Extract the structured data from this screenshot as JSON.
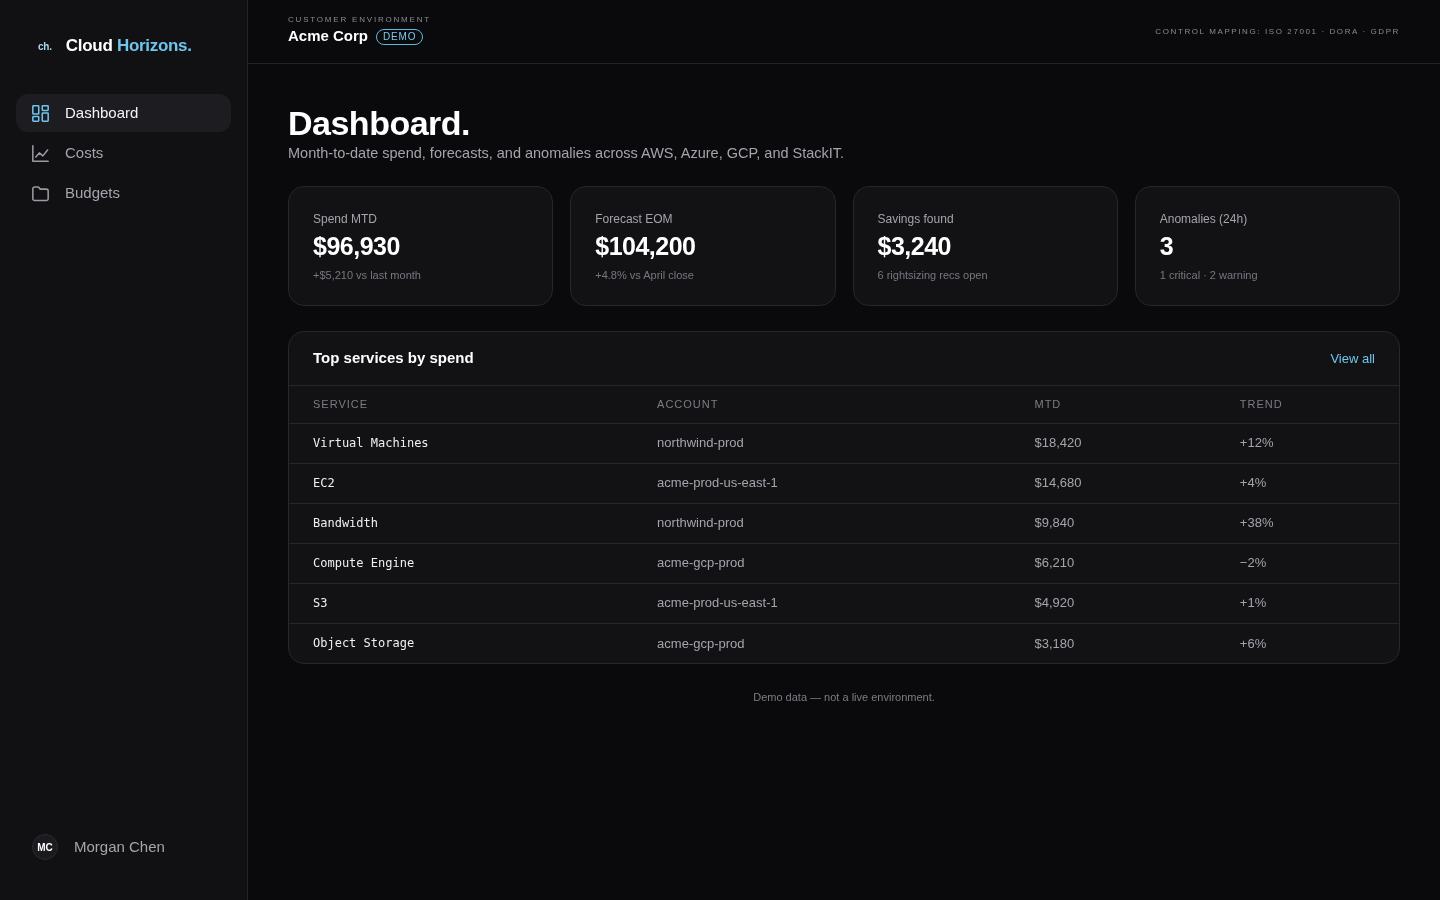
{
  "sidebar": {
    "logo_mark": "ch.",
    "brand": {
      "name": "Cloud",
      "accent": "Horizons."
    },
    "items": [
      {
        "label": "Dashboard",
        "selected": true
      },
      {
        "label": "Costs",
        "selected": false
      },
      {
        "label": "Budgets",
        "selected": false
      }
    ],
    "user": {
      "initials": "MC",
      "name": "Morgan Chen"
    }
  },
  "header": {
    "eyebrow": "CUSTOMER ENVIRONMENT",
    "customer": "Acme Corp",
    "badge": "DEMO",
    "compliance": "CONTROL MAPPING: ISO 27001 · DORA · GDPR"
  },
  "page": {
    "title": "Dashboard.",
    "subtitle": "Month-to-date spend, forecasts, and anomalies across AWS, Azure, GCP, and StackIT."
  },
  "stats": [
    {
      "label": "Spend MTD",
      "value": "$96,930",
      "note": "+$5,210 vs last month"
    },
    {
      "label": "Forecast EOM",
      "value": "$104,200",
      "note": "+4.8% vs April close"
    },
    {
      "label": "Savings found",
      "value": "$3,240",
      "note": "6 rightsizing recs open"
    },
    {
      "label": "Anomalies (24h)",
      "value": "3",
      "note": "1 critical · 2 warning"
    }
  ],
  "table": {
    "title": "Top services by spend",
    "link": "View all",
    "columns": [
      "SERVICE",
      "ACCOUNT",
      "MTD",
      "TREND"
    ],
    "rows": [
      [
        "Virtual Machines",
        "northwind-prod",
        "$18,420",
        "+12%"
      ],
      [
        "EC2",
        "acme-prod-us-east-1",
        "$14,680",
        "+4%"
      ],
      [
        "Bandwidth",
        "northwind-prod",
        "$9,840",
        "+38%"
      ],
      [
        "Compute Engine",
        "acme-gcp-prod",
        "$6,210",
        "−2%"
      ],
      [
        "S3",
        "acme-prod-us-east-1",
        "$4,920",
        "+1%"
      ],
      [
        "Object Storage",
        "acme-gcp-prod",
        "$3,180",
        "+6%"
      ]
    ]
  },
  "footer_note": "Demo data — not a live environment."
}
